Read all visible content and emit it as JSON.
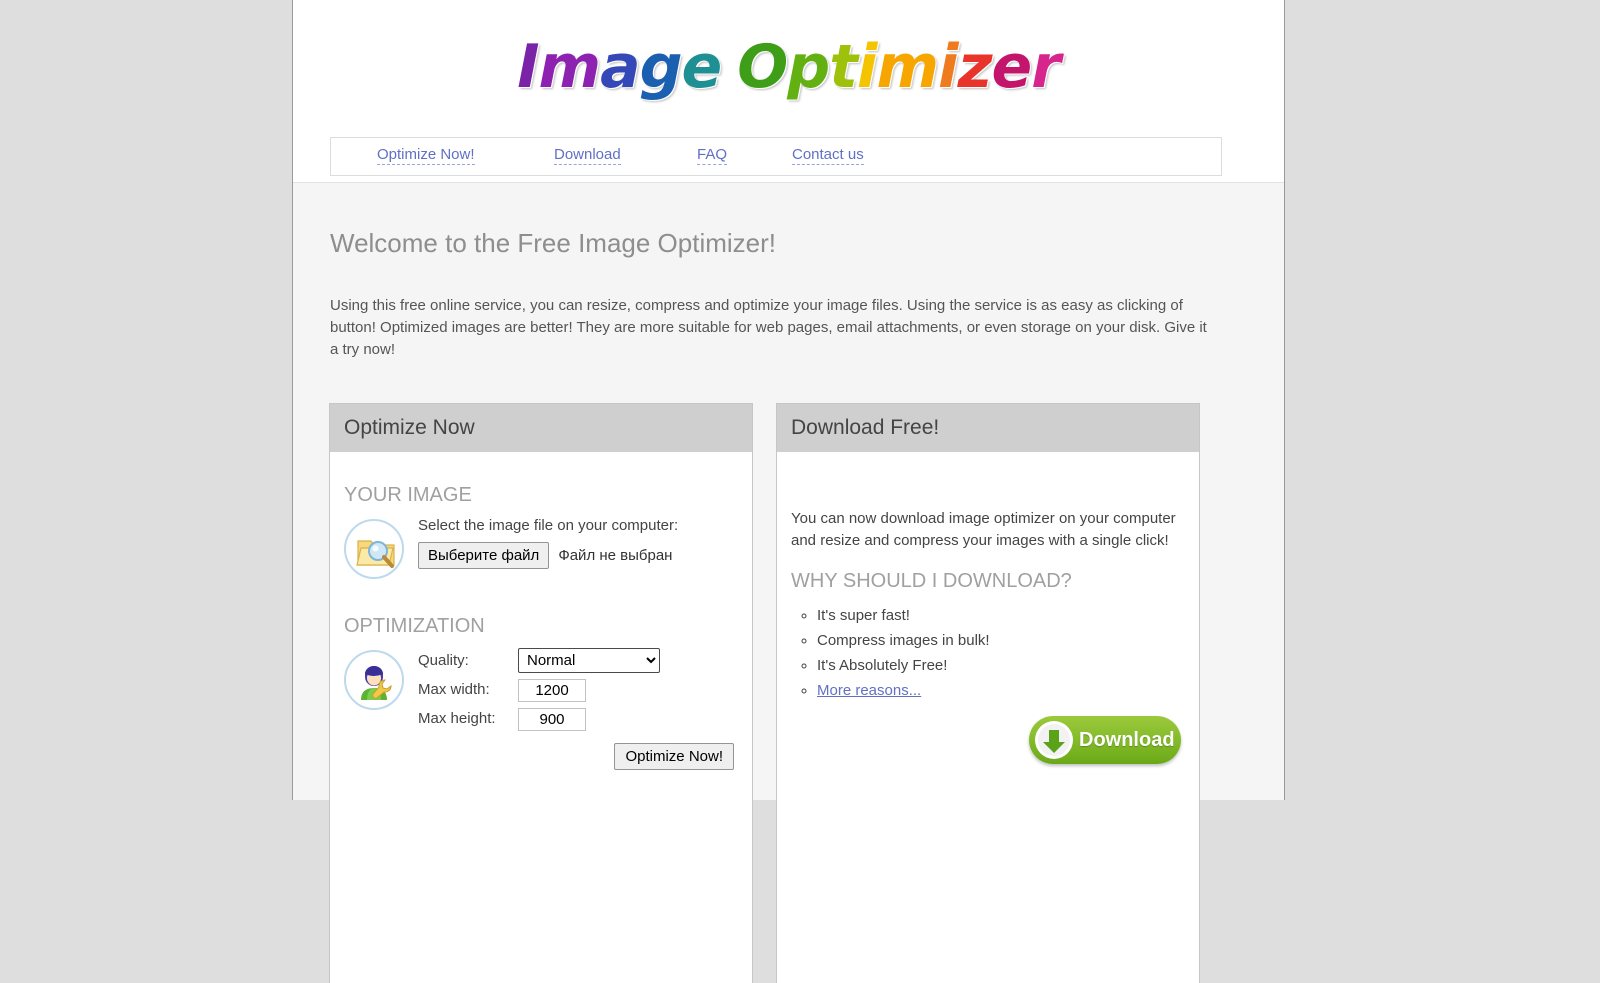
{
  "site": {
    "logo_text": "Image Optimizer",
    "logo_letters": [
      {
        "ch": "I",
        "color": "#7a22a8"
      },
      {
        "ch": "m",
        "color": "#8e22b0"
      },
      {
        "ch": "a",
        "color": "#3448b8"
      },
      {
        "ch": "g",
        "color": "#1b5fb0"
      },
      {
        "ch": "e",
        "color": "#1e8f92"
      },
      {
        "ch": "O",
        "color": "#3f9e18"
      },
      {
        "ch": "p",
        "color": "#63b012"
      },
      {
        "ch": "t",
        "color": "#9ec20c"
      },
      {
        "ch": "i",
        "color": "#f5c400"
      },
      {
        "ch": "m",
        "color": "#f7a600"
      },
      {
        "ch": "i",
        "color": "#f07b1e"
      },
      {
        "ch": "z",
        "color": "#e8342b"
      },
      {
        "ch": "e",
        "color": "#c2156b"
      },
      {
        "ch": "r",
        "color": "#d6268d"
      }
    ]
  },
  "nav": {
    "items": [
      {
        "label": "Optimize Now!",
        "name": "nav-link-optimize-now"
      },
      {
        "label": "Download",
        "name": "nav-link-download"
      },
      {
        "label": "FAQ",
        "name": "nav-link-faq"
      },
      {
        "label": "Contact us",
        "name": "nav-link-contact-us"
      }
    ]
  },
  "main": {
    "title": "Welcome to the Free Image Optimizer!",
    "intro": "Using this free online service, you can resize, compress and optimize your image files. Using the service is as easy as clicking of button! Optimized images are better! They are more suitable for web pages, email attachments, or even storage on your disk. Give it a try now!"
  },
  "optimize_panel": {
    "header": "Optimize Now",
    "your_image_title": "YOUR IMAGE",
    "select_file_label": "Select the image file on your computer:",
    "file_button_label": "Выберите файл",
    "file_status": "Файл не выбран",
    "file_icon": "folder-search-icon",
    "optimization_title": "OPTIMIZATION",
    "optimization_icon": "user-wrench-icon",
    "quality_label": "Quality:",
    "quality_value": "Normal",
    "quality_options": [
      "Normal"
    ],
    "max_width_label": "Max width:",
    "max_width_value": "1200",
    "max_height_label": "Max height:",
    "max_height_value": "900",
    "submit_label": "Optimize Now!"
  },
  "download_panel": {
    "header": "Download Free!",
    "intro": "You can now download image optimizer on your computer and resize and compress your images with a single click!",
    "why_title": "WHY SHOULD I DOWNLOAD?",
    "reasons": [
      {
        "label": "It's super fast!",
        "link": false
      },
      {
        "label": "Compress images in bulk!",
        "link": false
      },
      {
        "label": "It's Absolutely Free!",
        "link": false
      },
      {
        "label": "More reasons...",
        "link": true
      }
    ],
    "download_button_label": "Download",
    "download_button_icon": "download-arrow-icon"
  },
  "colors": {
    "page_background": "#dedede",
    "content_background": "#f5f5f5",
    "panel_header": "#cfcfcf",
    "link": "#6170c4",
    "heading_gray": "#8e8e8e",
    "section_title_gray": "#a0a0a0",
    "download_green": "#83bb2a"
  }
}
